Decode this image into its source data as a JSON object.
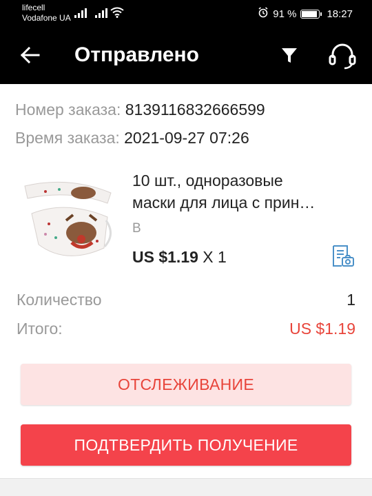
{
  "status_bar": {
    "carrier_1": "lifecell",
    "carrier_2": "Vodafone UA",
    "battery": "91 %",
    "battery_level": 0.91,
    "time": "18:27"
  },
  "header": {
    "title": "Отправлено",
    "back_icon": "arrow-left-icon",
    "filter_icon": "filter-icon",
    "support_icon": "headset-icon"
  },
  "order": {
    "number_label": "Номер заказа:",
    "number_value": "8139116832666599",
    "time_label": "Время заказа:",
    "time_value": "2021-09-27 07:26"
  },
  "product": {
    "title_line1": "10 шт., одноразовые",
    "title_line2": "маски для лица с прин…",
    "variant": "B",
    "price": "US $1.19",
    "quantity_text": "X 1"
  },
  "summary": {
    "quantity_label": "Количество",
    "quantity_value": "1",
    "total_label": "Итого:",
    "total_value": "US $1.19",
    "total_color": "#e8443a"
  },
  "buttons": {
    "track": "ОТСЛЕЖИВАНИЕ",
    "confirm": "ПОДТВЕРДИТЬ ПОЛУЧЕНИЕ"
  }
}
